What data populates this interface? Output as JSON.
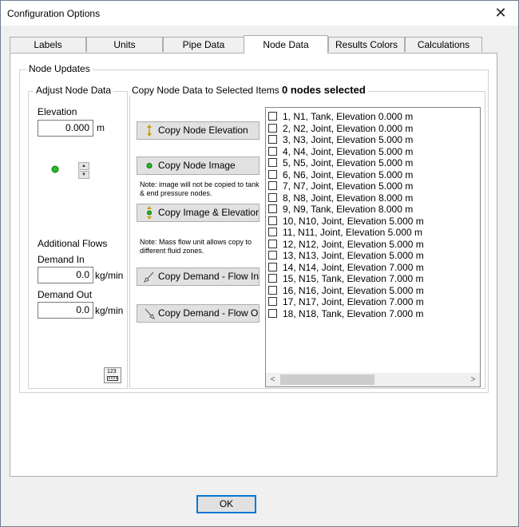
{
  "window": {
    "title": "Configuration Options",
    "close_glyph": "✕"
  },
  "tabs": [
    {
      "label": "Labels"
    },
    {
      "label": "Units"
    },
    {
      "label": "Pipe Data"
    },
    {
      "label": "Node Data",
      "active": true
    },
    {
      "label": "Results Colors"
    },
    {
      "label": "Calculations"
    }
  ],
  "node_updates": {
    "group_label": "Node Updates",
    "adjust": {
      "group_label": "Adjust Node Data",
      "elevation_label": "Elevation",
      "elevation_value": "0.000",
      "elevation_unit": "m",
      "spin_up": "▲",
      "spin_down": "▼",
      "additional_flows_label": "Additional Flows",
      "demand_in_label": "Demand In",
      "demand_in_value": "0.0",
      "demand_in_unit": "kg/min",
      "demand_out_label": "Demand Out",
      "demand_out_value": "0.0",
      "demand_out_unit": "kg/min",
      "calc_icon_text": "123"
    },
    "copy": {
      "header_label": "Copy Node Data to Selected Items:",
      "selected_count": "0 nodes selected",
      "btn_elevation": "Copy Node Elevation",
      "btn_image": "Copy Node Image",
      "note_image": "Note: image will not be copied to tank & end pressure nodes.",
      "btn_image_elevation": "Copy Image & Elevation",
      "note_mass": "Note: Mass flow unit allows copy to different fluid zones.",
      "btn_demand_in": "Copy Demand - Flow In",
      "btn_demand_out": "Copy Demand - Flow Out"
    },
    "nodes": [
      "1, N1, Tank, Elevation 0.000 m",
      "2, N2, Joint, Elevation 0.000 m",
      "3, N3, Joint, Elevation 5.000 m",
      "4, N4, Joint, Elevation 5.000 m",
      "5, N5, Joint, Elevation 5.000 m",
      "6, N6, Joint, Elevation 5.000 m",
      "7, N7, Joint, Elevation 5.000 m",
      "8, N8, Joint, Elevation 8.000 m",
      "9, N9, Tank, Elevation 8.000 m",
      "10, N10, Joint, Elevation 5.000 m",
      "11, N11, Joint, Elevation 5.000 m",
      "12, N12, Joint, Elevation 5.000 m",
      "13, N13, Joint, Elevation 5.000 m",
      "14, N14, Joint, Elevation 7.000 m",
      "15, N15, Tank, Elevation 7.000 m",
      "16, N16, Joint, Elevation 5.000 m",
      "17, N17, Joint, Elevation 7.000 m",
      "18, N18, Tank, Elevation 7.000 m"
    ],
    "scroll_left": "<",
    "scroll_right": ">"
  },
  "footer": {
    "ok_label": "OK"
  },
  "colors": {
    "accent": "#0078d7",
    "node_green": "#22c022",
    "arrow_green": "#2e9a2e"
  }
}
